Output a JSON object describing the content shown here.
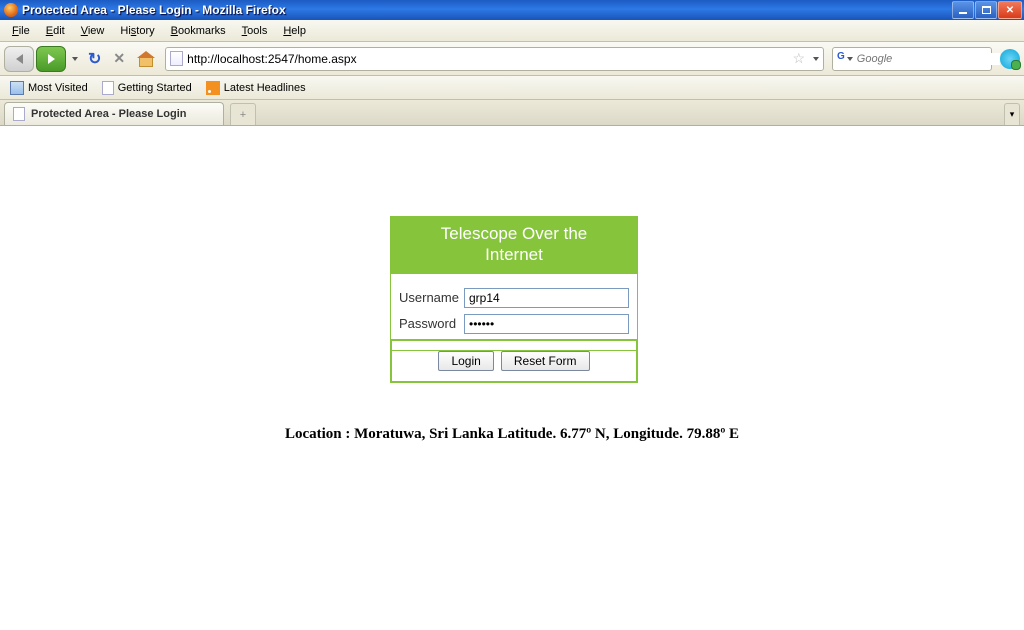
{
  "window": {
    "title": "Protected Area - Please Login - Mozilla Firefox"
  },
  "menu": {
    "file": "File",
    "edit": "Edit",
    "view": "View",
    "history": "History",
    "bookmarks": "Bookmarks",
    "tools": "Tools",
    "help": "Help"
  },
  "nav": {
    "url": "http://localhost:2547/home.aspx",
    "search_placeholder": "Google"
  },
  "bookmarks_bar": {
    "most_visited": "Most Visited",
    "getting_started": "Getting Started",
    "latest_headlines": "Latest Headlines"
  },
  "tab": {
    "title": "Protected Area - Please Login"
  },
  "login": {
    "title_line1": "Telescope Over the",
    "title_line2": "Internet",
    "username_label": "Username",
    "username_value": "grp14",
    "password_label": "Password",
    "password_value": "••••••",
    "login_btn": "Login",
    "reset_btn": "Reset Form"
  },
  "footer": {
    "location": "Location : Moratuwa, Sri Lanka Latitude. 6.77º N, Longitude. 79.88º E"
  }
}
